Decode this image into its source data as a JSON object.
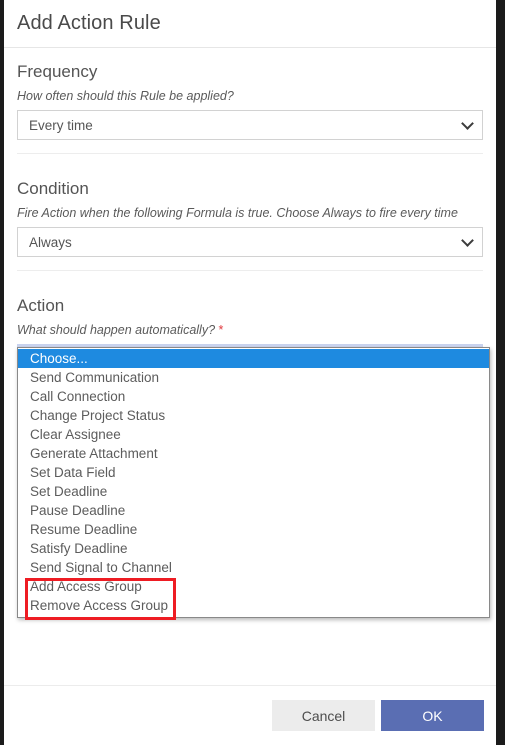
{
  "dialog": {
    "title": "Add Action Rule"
  },
  "sections": {
    "frequency": {
      "title": "Frequency",
      "hint": "How often should this Rule be applied?",
      "value": "Every time"
    },
    "condition": {
      "title": "Condition",
      "hint": "Fire Action when the following Formula is true. Choose Always to fire every time",
      "value": "Always"
    },
    "action": {
      "title": "Action",
      "hint": "What should happen automatically?",
      "required_marker": "*",
      "value": "Choose..."
    }
  },
  "action_dropdown": {
    "open": true,
    "selected_index": 0,
    "options": [
      "Choose...",
      "Send Communication",
      "Call Connection",
      "Change Project Status",
      "Clear Assignee",
      "Generate Attachment",
      "Set Data Field",
      "Set Deadline",
      "Pause Deadline",
      "Resume Deadline",
      "Satisfy Deadline",
      "Send Signal to Channel",
      "Add Access Group",
      "Remove Access Group"
    ],
    "highlighted_options": [
      "Add Access Group",
      "Remove Access Group"
    ]
  },
  "footer": {
    "cancel_label": "Cancel",
    "ok_label": "OK"
  },
  "colors": {
    "selected_option_bg": "#1e8ae0",
    "annotation_red": "#ee1c23",
    "ok_button_bg": "#5a6eb3",
    "cancel_button_bg": "#ececec",
    "required_star": "#e0393e"
  }
}
